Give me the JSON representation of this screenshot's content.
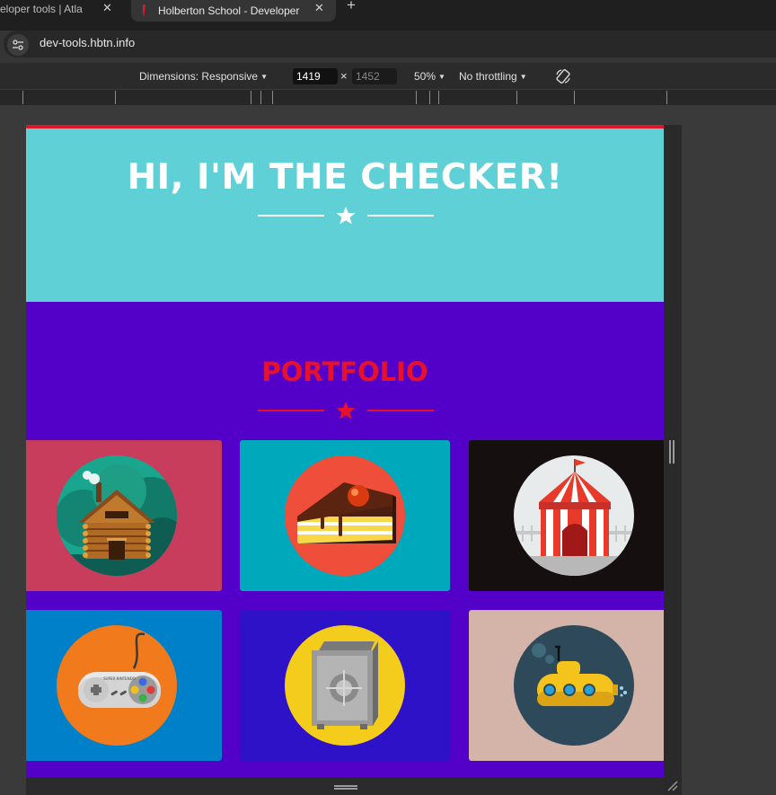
{
  "browser": {
    "tabs": [
      {
        "title": "eloper tools | Atla"
      },
      {
        "title": "Holberton School - Developer"
      }
    ],
    "new_tab_label": "+",
    "close_glyph": "✕",
    "url": "dev-tools.hbtn.info"
  },
  "devtools": {
    "dimensions_label": "Dimensions: Responsive",
    "width": "1419",
    "times": "×",
    "height": "1452",
    "zoom": "50%",
    "throttling": "No throttling",
    "rotate_icon": "rotate-icon"
  },
  "page": {
    "hero_title": "HI, I'M THE CHECKER!",
    "portfolio_title": "PORTFOLIO",
    "colors": {
      "hero_bg": "#5fd0d6",
      "portfolio_bg": "#5300c9",
      "accent_red": "#e8112d"
    },
    "cards": [
      {
        "icon": "log-cabin-icon",
        "bg": "#c83c5c"
      },
      {
        "icon": "cake-slice-icon",
        "bg": "#00a8bc"
      },
      {
        "icon": "circus-tent-icon",
        "bg": "#150f10"
      },
      {
        "icon": "game-controller-icon",
        "bg": "#0080c8"
      },
      {
        "icon": "safe-icon",
        "bg": "#2e12c8"
      },
      {
        "icon": "submarine-icon",
        "bg": "#d4b4a8"
      }
    ],
    "controller_brand": "SUPER NINTENDO"
  }
}
